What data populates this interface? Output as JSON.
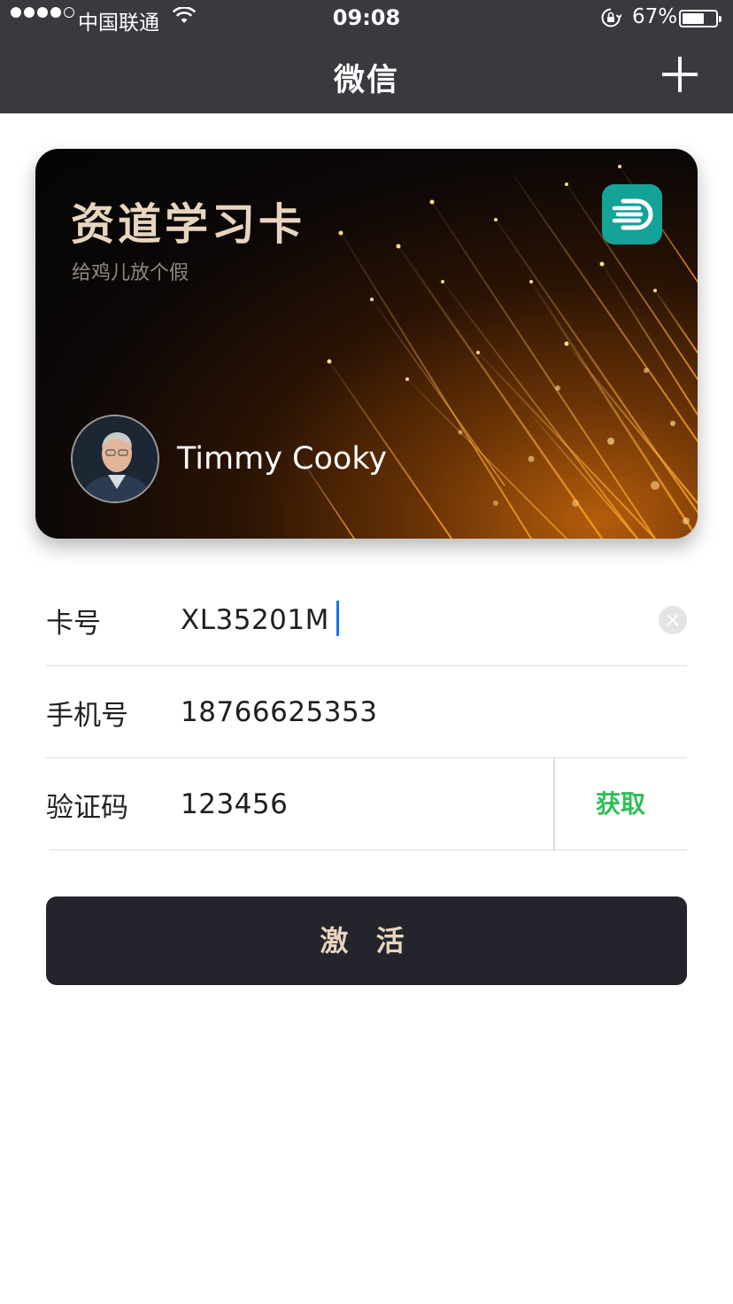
{
  "status_bar": {
    "carrier": "中国联通",
    "time": "09:08",
    "battery": "67%",
    "battery_level": 0.67
  },
  "nav": {
    "title": "微信",
    "add_icon": "plus-icon"
  },
  "card": {
    "title": "资道学习卡",
    "subtitle": "给鸡儿放个假",
    "logo_icon": "brand-d-logo",
    "holder_name": "Timmy Cooky",
    "colors": {
      "title": "#e8d5c0",
      "logo_bg": "#14a397"
    }
  },
  "form": {
    "card_number_label": "卡号",
    "card_number_value": "XL35201M",
    "phone_label": "手机号",
    "phone_value": "18766625353",
    "code_label": "验证码",
    "code_value": "123456",
    "get_code_label": "获取",
    "clear_icon": "clear-icon"
  },
  "activate_button": "激 活",
  "colors": {
    "nav_bg": "#393a3f",
    "accent_green": "#2fbf55",
    "button_bg": "#23242c",
    "caret": "#1a73e8"
  }
}
